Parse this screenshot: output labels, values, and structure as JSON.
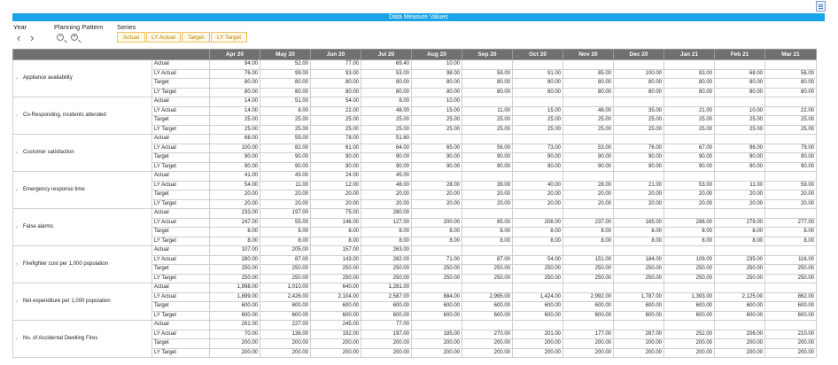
{
  "title": "Data Measure Values",
  "controls": {
    "year_label": "Year",
    "planning_label": "Planning Pattern",
    "series_label": "Series",
    "series_buttons": [
      "Actual",
      "LY Actual",
      "Target",
      "LY Target"
    ]
  },
  "months": [
    "Apr 20",
    "May 20",
    "Jun 20",
    "Jul 20",
    "Aug 20",
    "Sep 20",
    "Oct 20",
    "Nov 20",
    "Dec 20",
    "Jan 21",
    "Feb 21",
    "Mar 21"
  ],
  "rows": [
    {
      "measure": "Appliance availability",
      "series": [
        {
          "name": "Actual",
          "values": [
            "94.00",
            "52.00",
            "77.00",
            "69.40",
            "10.00",
            "",
            "",
            "",
            "",
            "",
            "",
            ""
          ]
        },
        {
          "name": "LY Actual",
          "values": [
            "76.00",
            "99.00",
            "93.00",
            "53.00",
            "98.00",
            "59.00",
            "91.00",
            "85.00",
            "100.00",
            "83.00",
            "68.00",
            "56.00"
          ]
        },
        {
          "name": "Target",
          "values": [
            "80.00",
            "80.00",
            "80.00",
            "80.00",
            "80.00",
            "80.00",
            "80.00",
            "80.00",
            "80.00",
            "80.00",
            "80.00",
            "80.00"
          ]
        },
        {
          "name": "LY Target",
          "values": [
            "80.00",
            "80.00",
            "80.00",
            "80.00",
            "80.00",
            "80.00",
            "80.00",
            "80.00",
            "80.00",
            "80.00",
            "80.00",
            "80.00"
          ]
        }
      ]
    },
    {
      "measure": "Co-Responding, incidents attended",
      "series": [
        {
          "name": "Actual",
          "values": [
            "14.00",
            "51.00",
            "54.00",
            "8.00",
            "10.00",
            "",
            "",
            "",
            "",
            "",
            "",
            ""
          ]
        },
        {
          "name": "LY Actual",
          "values": [
            "14.00",
            "8.00",
            "22.00",
            "48.00",
            "15.00",
            "11.00",
            "15.00",
            "48.00",
            "35.00",
            "21.00",
            "10.00",
            "22.00"
          ]
        },
        {
          "name": "Target",
          "values": [
            "25.00",
            "25.00",
            "25.00",
            "25.00",
            "25.00",
            "25.00",
            "25.00",
            "25.00",
            "25.00",
            "25.00",
            "25.00",
            "25.00"
          ]
        },
        {
          "name": "LY Target",
          "values": [
            "25.00",
            "25.00",
            "25.00",
            "25.00",
            "25.00",
            "25.00",
            "25.00",
            "25.00",
            "25.00",
            "25.00",
            "25.00",
            "25.00"
          ]
        }
      ]
    },
    {
      "measure": "Customer satisfaction",
      "series": [
        {
          "name": "Actual",
          "values": [
            "68.00",
            "55.00",
            "78.00",
            "51.60",
            "",
            "",
            "",
            "",
            "",
            "",
            "",
            ""
          ]
        },
        {
          "name": "LY Actual",
          "values": [
            "100.00",
            "82.00",
            "61.00",
            "64.00",
            "65.00",
            "56.00",
            "73.00",
            "53.00",
            "76.00",
            "67.00",
            "96.00",
            "79.00"
          ]
        },
        {
          "name": "Target",
          "values": [
            "90.00",
            "90.00",
            "90.00",
            "90.00",
            "90.00",
            "90.00",
            "90.00",
            "90.00",
            "90.00",
            "90.00",
            "90.00",
            "90.00"
          ]
        },
        {
          "name": "LY Target",
          "values": [
            "90.00",
            "90.00",
            "90.00",
            "90.00",
            "90.00",
            "90.00",
            "90.00",
            "90.00",
            "90.00",
            "90.00",
            "90.00",
            "90.00"
          ]
        }
      ]
    },
    {
      "measure": "Emergency response time",
      "series": [
        {
          "name": "Actual",
          "values": [
            "41.00",
            "43.00",
            "24.00",
            "45.00",
            "",
            "",
            "",
            "",
            "",
            "",
            "",
            ""
          ]
        },
        {
          "name": "LY Actual",
          "values": [
            "54.00",
            "11.00",
            "12.00",
            "48.00",
            "28.00",
            "39.00",
            "40.00",
            "28.00",
            "21.00",
            "53.00",
            "11.00",
            "59.00"
          ]
        },
        {
          "name": "Target",
          "values": [
            "20.00",
            "20.00",
            "20.00",
            "20.00",
            "20.00",
            "20.00",
            "20.00",
            "20.00",
            "20.00",
            "20.00",
            "20.00",
            "20.00"
          ]
        },
        {
          "name": "LY Target",
          "values": [
            "20.00",
            "20.00",
            "20.00",
            "20.00",
            "20.00",
            "20.00",
            "20.00",
            "20.00",
            "20.00",
            "20.00",
            "20.00",
            "20.00"
          ]
        }
      ]
    },
    {
      "measure": "False alarms",
      "series": [
        {
          "name": "Actual",
          "values": [
            "233.00",
            "197.00",
            "75.00",
            "280.00",
            "",
            "",
            "",
            "",
            "",
            "",
            "",
            ""
          ]
        },
        {
          "name": "LY Actual",
          "values": [
            "247.00",
            "55.00",
            "146.00",
            "127.00",
            "200.00",
            "85.00",
            "208.00",
            "237.00",
            "165.00",
            "296.00",
            "279.00",
            "277.00"
          ]
        },
        {
          "name": "Target",
          "values": [
            "8.00",
            "8.00",
            "8.00",
            "8.00",
            "8.00",
            "8.00",
            "8.00",
            "8.00",
            "8.00",
            "8.00",
            "8.00",
            "8.00"
          ]
        },
        {
          "name": "LY Target",
          "values": [
            "8.00",
            "8.00",
            "8.00",
            "8.00",
            "8.00",
            "8.00",
            "8.00",
            "8.00",
            "8.00",
            "8.00",
            "8.00",
            "8.00"
          ]
        }
      ]
    },
    {
      "measure": "Firefighter cost per 1,000 population",
      "series": [
        {
          "name": "Actual",
          "values": [
            "107.00",
            "205.00",
            "157.00",
            "263.00",
            "",
            "",
            "",
            "",
            "",
            "",
            "",
            ""
          ]
        },
        {
          "name": "LY Actual",
          "values": [
            "280.00",
            "87.00",
            "143.00",
            "282.00",
            "71.00",
            "87.00",
            "54.00",
            "151.00",
            "184.00",
            "109.00",
            "235.00",
            "116.00"
          ]
        },
        {
          "name": "Target",
          "values": [
            "250.00",
            "250.00",
            "250.00",
            "250.00",
            "250.00",
            "250.00",
            "250.00",
            "250.00",
            "250.00",
            "250.00",
            "250.00",
            "250.00"
          ]
        },
        {
          "name": "LY Target",
          "values": [
            "250.00",
            "250.00",
            "250.00",
            "250.00",
            "250.00",
            "250.00",
            "250.00",
            "250.00",
            "250.00",
            "250.00",
            "250.00",
            "250.00"
          ]
        }
      ]
    },
    {
      "measure": "Net expenditure per 1,000 population",
      "series": [
        {
          "name": "Actual",
          "values": [
            "1,998.00",
            "1,010.00",
            "640.00",
            "1,281.00",
            "",
            "",
            "",
            "",
            "",
            "",
            "",
            ""
          ]
        },
        {
          "name": "LY Actual",
          "values": [
            "1,899.00",
            "2,426.00",
            "2,104.00",
            "2,587.00",
            "884.00",
            "2,995.00",
            "1,424.00",
            "2,992.00",
            "1,787.00",
            "1,393.00",
            "2,125.00",
            "862.00"
          ]
        },
        {
          "name": "Target",
          "values": [
            "600.00",
            "600.00",
            "600.00",
            "600.00",
            "600.00",
            "600.00",
            "600.00",
            "600.00",
            "600.00",
            "600.00",
            "600.00",
            "600.00"
          ]
        },
        {
          "name": "LY Target",
          "values": [
            "600.00",
            "600.00",
            "600.00",
            "600.00",
            "600.00",
            "600.00",
            "600.00",
            "600.00",
            "600.00",
            "600.00",
            "600.00",
            "600.00"
          ]
        }
      ]
    },
    {
      "measure": "No. of Accidental Dwelling Fires",
      "series": [
        {
          "name": "Actual",
          "values": [
            "261.00",
            "227.00",
            "245.00",
            "77.00",
            "",
            "",
            "",
            "",
            "",
            "",
            "",
            ""
          ]
        },
        {
          "name": "LY Actual",
          "values": [
            "70.00",
            "136.00",
            "192.00",
            "197.00",
            "185.00",
            "270.00",
            "201.00",
            "177.00",
            "287.00",
            "252.00",
            "206.00",
            "210.00"
          ]
        },
        {
          "name": "Target",
          "values": [
            "200.00",
            "200.00",
            "200.00",
            "200.00",
            "200.00",
            "200.00",
            "200.00",
            "200.00",
            "200.00",
            "200.00",
            "200.00",
            "200.00"
          ]
        },
        {
          "name": "LY Target",
          "values": [
            "200.00",
            "200.00",
            "200.00",
            "200.00",
            "200.00",
            "200.00",
            "200.00",
            "200.00",
            "200.00",
            "200.00",
            "200.00",
            "200.00"
          ]
        }
      ]
    }
  ]
}
